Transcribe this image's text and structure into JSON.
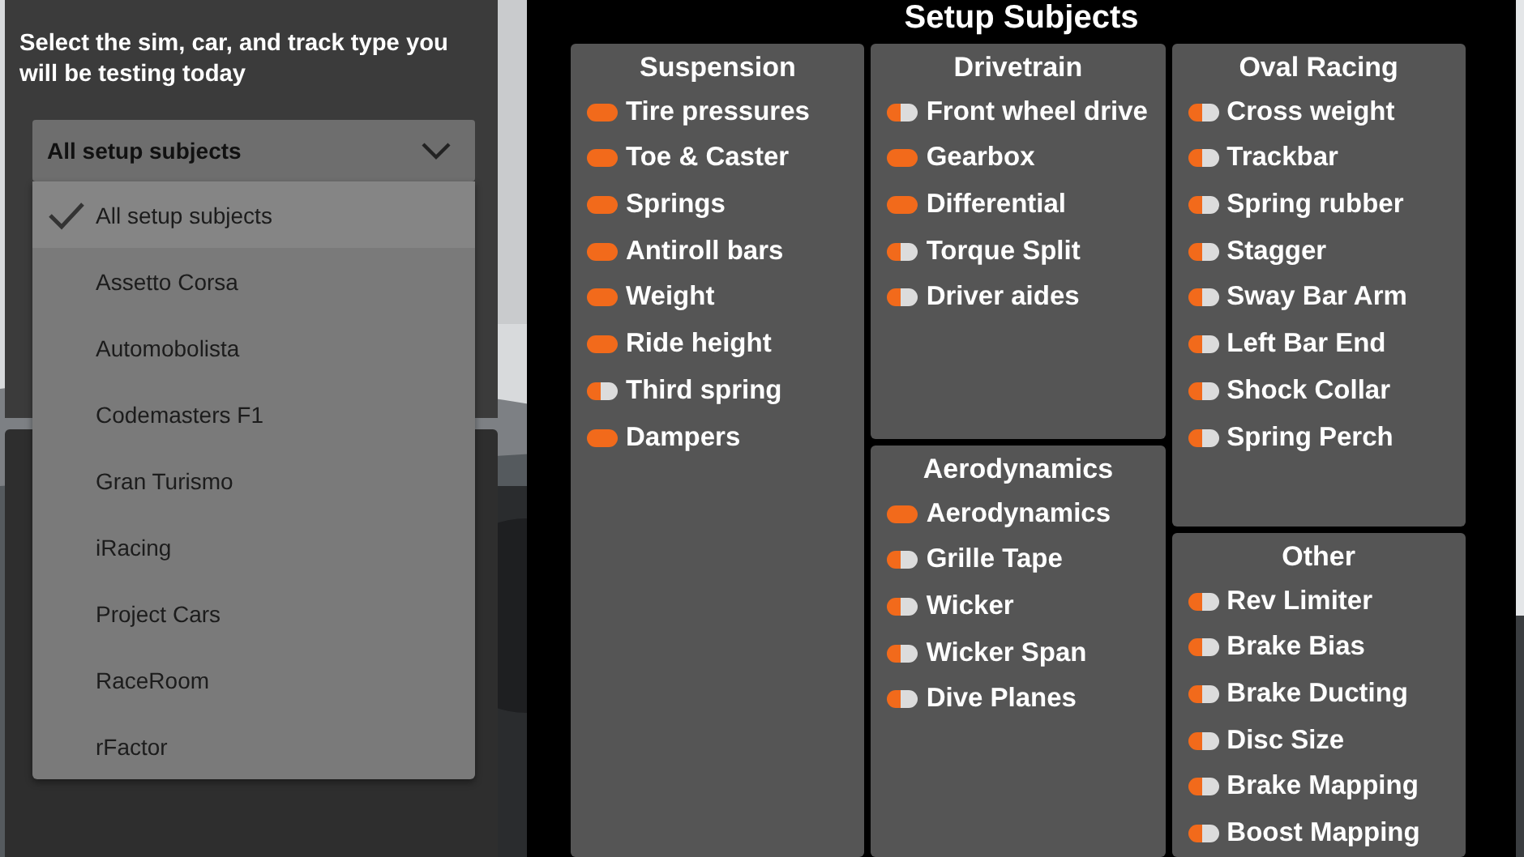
{
  "sidebar": {
    "instruction": "Select the sim, car, and track type you will be testing today",
    "dropdown": {
      "value": "All setup subjects",
      "expanded": true,
      "options": [
        {
          "label": "All setup subjects",
          "selected": true
        },
        {
          "label": "Assetto Corsa",
          "selected": false
        },
        {
          "label": "Automobolista",
          "selected": false
        },
        {
          "label": "Codemasters F1",
          "selected": false
        },
        {
          "label": "Gran Turismo",
          "selected": false
        },
        {
          "label": "iRacing",
          "selected": false
        },
        {
          "label": "Project Cars",
          "selected": false
        },
        {
          "label": "RaceRoom",
          "selected": false
        },
        {
          "label": "rFactor",
          "selected": false
        }
      ]
    }
  },
  "title": "Setup Subjects",
  "columns": [
    [
      {
        "title": "Suspension",
        "items": [
          {
            "label": "Tire pressures",
            "on": true
          },
          {
            "label": "Toe & Caster",
            "on": true
          },
          {
            "label": "Springs",
            "on": true
          },
          {
            "label": "Antiroll bars",
            "on": true
          },
          {
            "label": "Weight",
            "on": true
          },
          {
            "label": "Ride height",
            "on": true
          },
          {
            "label": "Third spring",
            "on": false
          },
          {
            "label": "Dampers",
            "on": true
          }
        ]
      }
    ],
    [
      {
        "title": "Drivetrain",
        "items": [
          {
            "label": "Front wheel drive",
            "on": false
          },
          {
            "label": "Gearbox",
            "on": true
          },
          {
            "label": "Differential",
            "on": true
          },
          {
            "label": "Torque Split",
            "on": false
          },
          {
            "label": "Driver aides",
            "on": false
          }
        ]
      },
      {
        "title": "Aerodynamics",
        "items": [
          {
            "label": "Aerodynamics",
            "on": true
          },
          {
            "label": "Grille Tape",
            "on": false
          },
          {
            "label": "Wicker",
            "on": false
          },
          {
            "label": "Wicker Span",
            "on": false
          },
          {
            "label": "Dive Planes",
            "on": false
          }
        ]
      }
    ],
    [
      {
        "title": "Oval Racing",
        "items": [
          {
            "label": "Cross weight",
            "on": false
          },
          {
            "label": "Trackbar",
            "on": false
          },
          {
            "label": "Spring rubber",
            "on": false
          },
          {
            "label": "Stagger",
            "on": false
          },
          {
            "label": "Sway Bar Arm",
            "on": false
          },
          {
            "label": "Left Bar End",
            "on": false
          },
          {
            "label": "Shock Collar",
            "on": false
          },
          {
            "label": "Spring Perch",
            "on": false
          }
        ]
      },
      {
        "title": "Other",
        "items": [
          {
            "label": "Rev Limiter",
            "on": false
          },
          {
            "label": "Brake Bias",
            "on": false
          },
          {
            "label": "Brake Ducting",
            "on": false
          },
          {
            "label": "Disc Size",
            "on": false
          },
          {
            "label": "Brake Mapping",
            "on": false
          },
          {
            "label": "Boost Mapping",
            "on": false
          }
        ]
      }
    ]
  ]
}
